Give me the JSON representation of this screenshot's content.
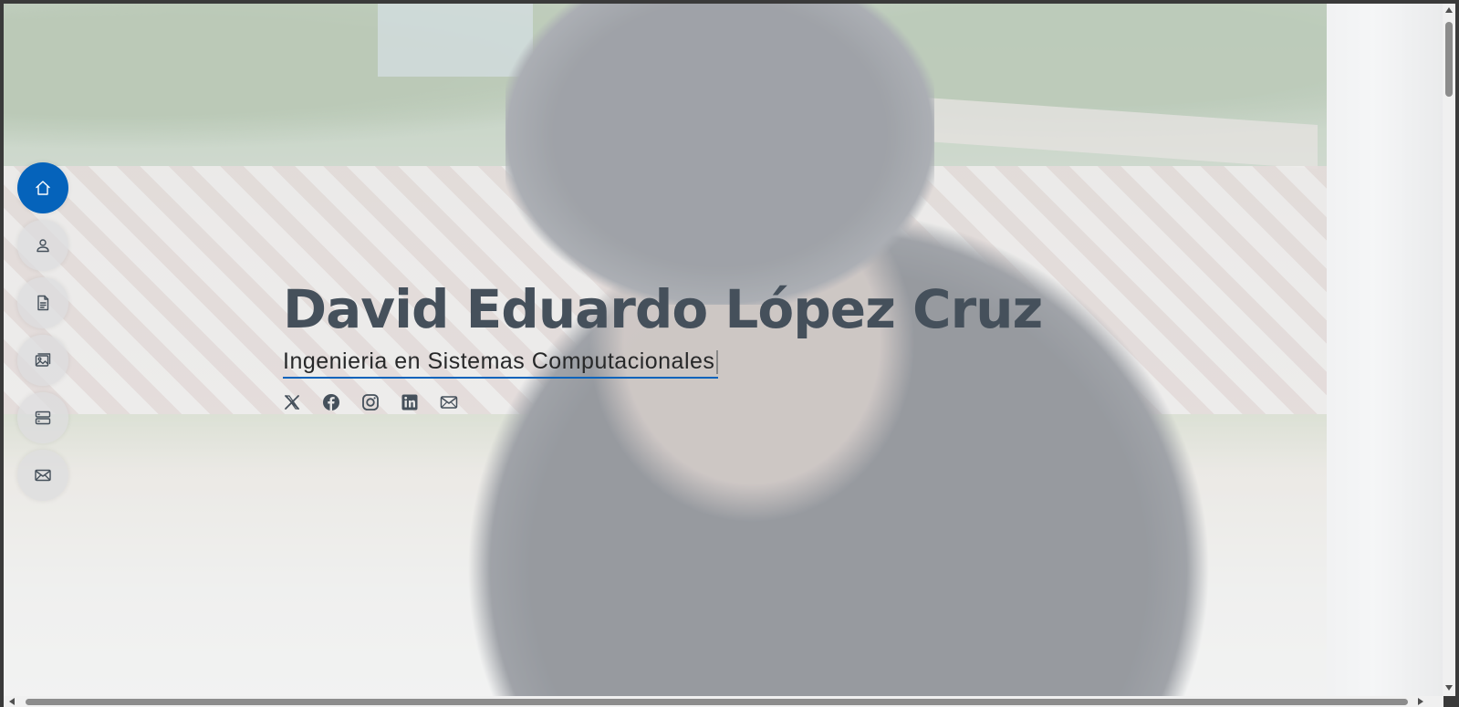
{
  "hero": {
    "name": "David Eduardo López Cruz",
    "subtitle": "Ingenieria en Sistemas Computacionales"
  },
  "side_nav": {
    "items": [
      {
        "icon": "home-icon",
        "active": true
      },
      {
        "icon": "person-icon",
        "active": false
      },
      {
        "icon": "file-text-icon",
        "active": false
      },
      {
        "icon": "images-icon",
        "active": false
      },
      {
        "icon": "server-icon",
        "active": false
      },
      {
        "icon": "envelope-icon",
        "active": false
      }
    ]
  },
  "social_links": [
    {
      "icon": "twitter-x-icon"
    },
    {
      "icon": "facebook-icon"
    },
    {
      "icon": "instagram-icon"
    },
    {
      "icon": "linkedin-icon"
    },
    {
      "icon": "envelope-icon"
    }
  ],
  "colors": {
    "accent": "#0563bb",
    "heading": "#45505b",
    "text": "#272829"
  }
}
